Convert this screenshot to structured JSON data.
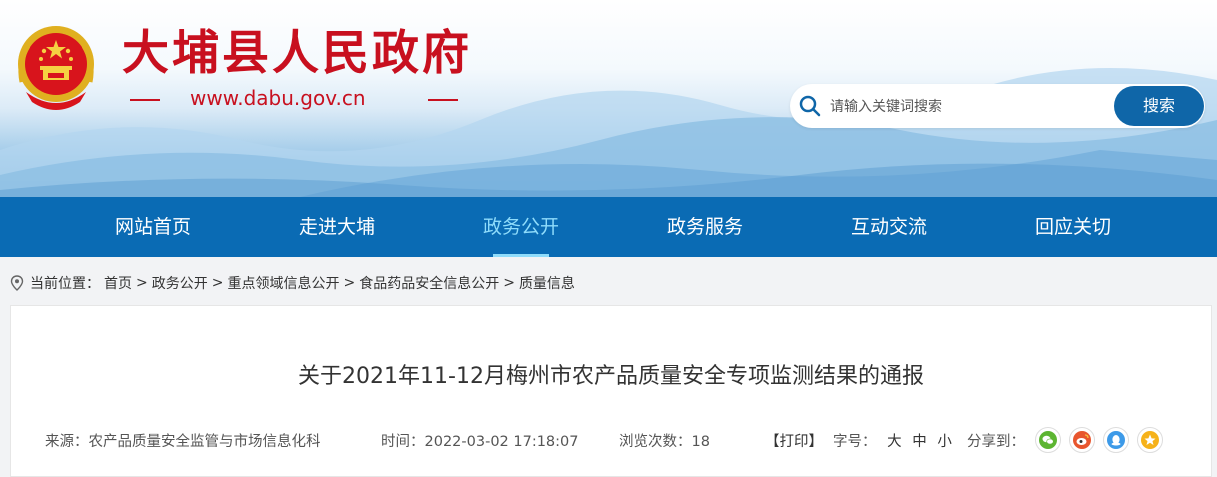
{
  "header": {
    "site_title": "大埔县人民政府",
    "site_url": "www.dabu.gov.cn",
    "brand_color": "#c8101f"
  },
  "search": {
    "placeholder": "请输入关键词搜索",
    "button_label": "搜索"
  },
  "nav": {
    "items": [
      {
        "label": "网站首页"
      },
      {
        "label": "走进大埔"
      },
      {
        "label": "政务公开"
      },
      {
        "label": "政务服务"
      },
      {
        "label": "互动交流"
      },
      {
        "label": "回应关切"
      }
    ],
    "active_index": 2,
    "bg_color": "#0a6bb4"
  },
  "breadcrumb": {
    "prefix": "当前位置：",
    "items": [
      "首页",
      "政务公开",
      "重点领域信息公开",
      "食品药品安全信息公开",
      "质量信息"
    ],
    "separator": ">"
  },
  "article": {
    "title": "关于2021年11-12月梅州市农产品质量安全专项监测结果的通报",
    "source": "来源：农产品质量安全监管与市场信息化科",
    "time": "时间：2022-03-02 17:18:07",
    "views": "浏览次数：18",
    "print_label": "【打印】",
    "font_size_label": "字号：",
    "font_sizes": [
      "大",
      "中",
      "小"
    ],
    "share_label": "分享到："
  },
  "share_icons": [
    "wechat-icon",
    "weibo-icon",
    "qq-icon",
    "qzone-icon"
  ]
}
